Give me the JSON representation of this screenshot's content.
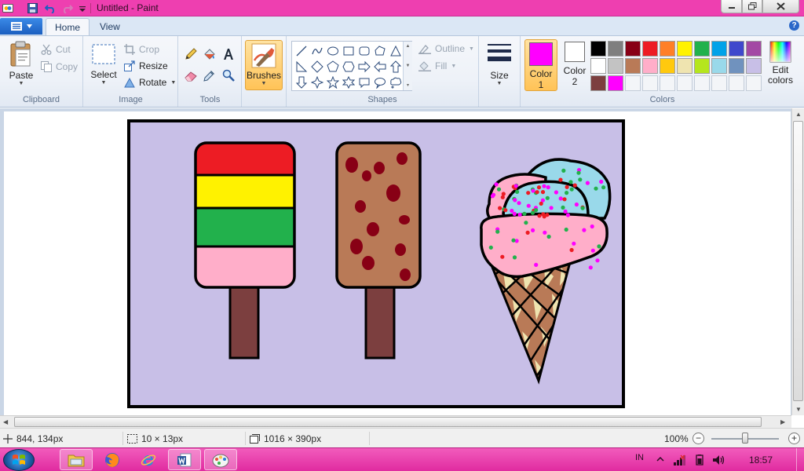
{
  "window": {
    "title": "Untitled - Paint"
  },
  "tabs": {
    "home": "Home",
    "view": "View"
  },
  "help_icon": "?",
  "ribbon": {
    "clipboard": {
      "group_label": "Clipboard",
      "paste": "Paste",
      "cut": "Cut",
      "copy": "Copy"
    },
    "image": {
      "group_label": "Image",
      "select": "Select",
      "crop": "Crop",
      "resize": "Resize",
      "rotate": "Rotate"
    },
    "tools": {
      "group_label": "Tools",
      "icons": [
        "pencil-icon",
        "fill-icon",
        "text-icon",
        "eraser-icon",
        "color-picker-icon",
        "magnifier-icon"
      ]
    },
    "brushes": {
      "label": "Brushes"
    },
    "shapes": {
      "group_label": "Shapes",
      "outline": "Outline",
      "fill": "Fill"
    },
    "size": {
      "label": "Size"
    },
    "colors": {
      "group_label": "Colors",
      "color1": {
        "label": "Color",
        "num": "1",
        "value": "#ff00ff"
      },
      "color2": {
        "label": "Color",
        "num": "2",
        "value": "#ffffff"
      },
      "edit_colors": "Edit colors",
      "palette_row1": [
        "#000000",
        "#7f7f7f",
        "#880015",
        "#ed1c24",
        "#ff7f27",
        "#fff200",
        "#22b14c",
        "#00a2e8",
        "#3f48cc",
        "#a349a4"
      ],
      "palette_row2": [
        "#ffffff",
        "#c3c3c3",
        "#b97a57",
        "#ffaec9",
        "#ffc90e",
        "#efe4b0",
        "#b5e61d",
        "#99d9ea",
        "#7092be",
        "#c8bfe7"
      ],
      "palette_row3": [
        "#7c3f3f",
        "#ff00ff"
      ]
    }
  },
  "canvas": {
    "background": "#c8bfe7",
    "frame_color": "#000000",
    "popsicle_stripes": [
      "#ed1c24",
      "#fff200",
      "#22b14c",
      "#ffaec9"
    ],
    "chocolate_bar": "#b97a57",
    "chocolate_spots": "#880015",
    "stick": "#7c3f3f",
    "cone": [
      "#b97a57",
      "#efe4b0"
    ],
    "scoop_pink": "#ffaec9",
    "scoop_blue": "#99d9ea",
    "sprinkles": [
      "#22b14c",
      "#ff00ff",
      "#ed1c24"
    ]
  },
  "status": {
    "cursor": "844, 134px",
    "selection": "10 × 13px",
    "canvas_size": "1016 × 390px",
    "zoom": "100%"
  },
  "taskbar": {
    "lang": "IN",
    "time": "18:57"
  }
}
